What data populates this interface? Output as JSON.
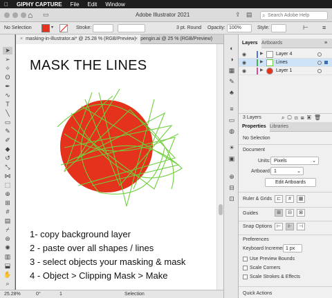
{
  "menubar": {
    "apple": "",
    "app_name": "GIPHY CAPTURE",
    "items": [
      "File",
      "Edit",
      "Window"
    ]
  },
  "window": {
    "title": "Adobe Illustrator 2021",
    "search_placeholder": "Search Adobe Help"
  },
  "control_bar": {
    "selection": "No Selection",
    "stroke_label": "Stroke:",
    "brush": "3 pt. Round",
    "opacity_label": "Opacity:",
    "opacity": "100%",
    "style_label": "Style:"
  },
  "doc_tabs": [
    {
      "label": "masking-in-illustrator.ai* @ 25.28 % (RGB/Preview)"
    },
    {
      "label": "pengin.ai @ 25 % (RGB/Preview)"
    }
  ],
  "canvas": {
    "heading": "MASK THE LINES",
    "steps": [
      "1- copy background layer",
      "2 - paste over all shapes / lines",
      "3 - select objects your masking & mask",
      "4 - Object > Clipping Mask > Make"
    ],
    "colors": {
      "circle": "#e5321c",
      "lines": "#6fcf3c"
    }
  },
  "status_bar": {
    "zoom": "25.28%",
    "angle": "0°",
    "artboard": "1",
    "mode": "Selection"
  },
  "layers_panel": {
    "tabs": [
      "Layers",
      "Artboards"
    ],
    "layers": [
      {
        "name": "Layer 4",
        "color": "#4a74d6",
        "selected": false
      },
      {
        "name": "Lines",
        "color": "#4caf50",
        "selected": true
      },
      {
        "name": "Layer 1",
        "color": "#d64aa0",
        "selected": false
      }
    ],
    "count": "3 Layers"
  },
  "properties_panel": {
    "tabs": [
      "Properties",
      "Libraries"
    ],
    "selection": "No Selection",
    "document_title": "Document",
    "units_label": "Units:",
    "units": "Pixels",
    "artboard_label": "Artboard:",
    "artboard": "1",
    "edit_artboards": "Edit Artboards",
    "ruler_grids": "Ruler & Grids",
    "guides": "Guides",
    "snap_options": "Snap Options",
    "preferences": "Preferences",
    "keyboard_increment_label": "Keyboard Increment:",
    "keyboard_increment": "1 px",
    "checkboxes": [
      "Use Preview Bounds",
      "Scale Corners",
      "Scale Strokes & Effects"
    ],
    "quick_actions": "Quick Actions"
  }
}
